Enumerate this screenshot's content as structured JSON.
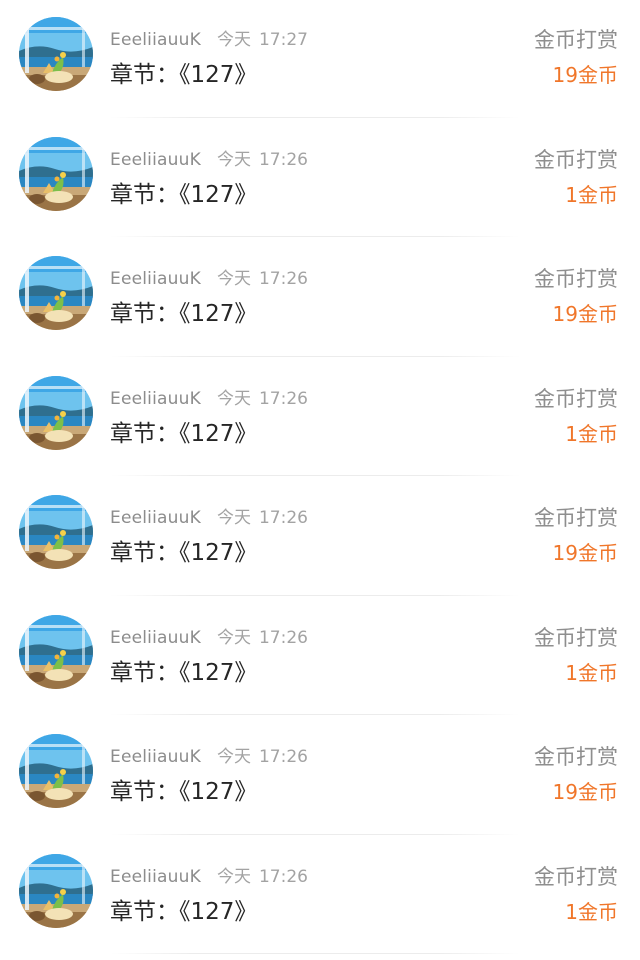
{
  "reward_list": {
    "items": [
      {
        "username": "EeeliiauuK",
        "day": "今天",
        "time": "17:27",
        "chapter": "章节：《127》",
        "reward_label": "金币打赏",
        "amount": "19金币"
      },
      {
        "username": "EeeliiauuK",
        "day": "今天",
        "time": "17:26",
        "chapter": "章节：《127》",
        "reward_label": "金币打赏",
        "amount": "1金币"
      },
      {
        "username": "EeeliiauuK",
        "day": "今天",
        "time": "17:26",
        "chapter": "章节：《127》",
        "reward_label": "金币打赏",
        "amount": "19金币"
      },
      {
        "username": "EeeliiauuK",
        "day": "今天",
        "time": "17:26",
        "chapter": "章节：《127》",
        "reward_label": "金币打赏",
        "amount": "1金币"
      },
      {
        "username": "EeeliiauuK",
        "day": "今天",
        "time": "17:26",
        "chapter": "章节：《127》",
        "reward_label": "金币打赏",
        "amount": "19金币"
      },
      {
        "username": "EeeliiauuK",
        "day": "今天",
        "time": "17:26",
        "chapter": "章节：《127》",
        "reward_label": "金币打赏",
        "amount": "1金币"
      },
      {
        "username": "EeeliiauuK",
        "day": "今天",
        "time": "17:26",
        "chapter": "章节：《127》",
        "reward_label": "金币打赏",
        "amount": "19金币"
      },
      {
        "username": "EeeliiauuK",
        "day": "今天",
        "time": "17:26",
        "chapter": "章节：《127》",
        "reward_label": "金币打赏",
        "amount": "1金币"
      }
    ]
  },
  "colors": {
    "amount": "#f0762a",
    "label": "#8e8e8e",
    "meta": "#a3a3a3",
    "chapter": "#262626"
  },
  "icons": {
    "avatar": "seaside-window-flower-avatar"
  }
}
